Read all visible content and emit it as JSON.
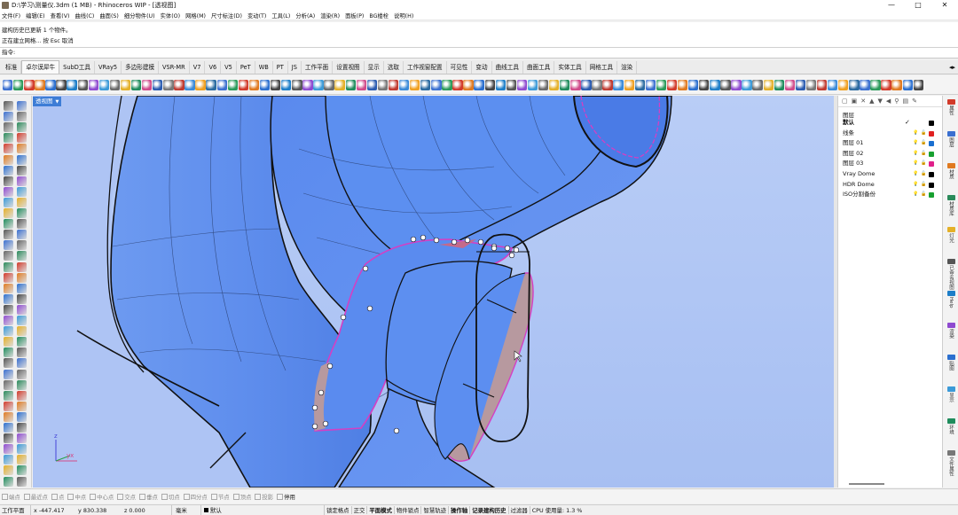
{
  "window": {
    "title": "D:\\学习\\测量仪.3dm (1 MB) - Rhinoceros WIP - [透视图]",
    "minimize": "—",
    "maximize": "□",
    "close": "✕"
  },
  "menu": [
    "文件(F)",
    "编辑(E)",
    "查看(V)",
    "曲线(C)",
    "曲面(S)",
    "细分物件(U)",
    "实体(O)",
    "网格(M)",
    "尺寸标注(D)",
    "变动(T)",
    "工具(L)",
    "分析(A)",
    "渲染(R)",
    "面板(P)",
    "BG楼栓",
    "说明(H)"
  ],
  "command_history": [
    "建构历史已更新 1 个物件。",
    "正在建立网格... 按 Esc 取消"
  ],
  "command_prompt": "指令:",
  "tabs": [
    "标准",
    "卓尔谟犀牛",
    "SubD工具",
    "VRay5",
    "多边形建模",
    "VSR-MR",
    "V7",
    "V6",
    "V5",
    "PeT",
    "WB",
    "PT",
    "JS",
    "工作平面",
    "设置视图",
    "显示",
    "选取",
    "工作视窗配置",
    "可见性",
    "变动",
    "曲线工具",
    "曲面工具",
    "实体工具",
    "网格工具",
    "渲染"
  ],
  "active_tab_index": 1,
  "viewport": {
    "label": "透视图",
    "axis_z": "z",
    "axis_yx": "yx"
  },
  "layers_panel": {
    "title": "图层",
    "layers": [
      {
        "name": "默认",
        "color": "#000000",
        "current": true,
        "bold": true
      },
      {
        "name": "线条",
        "color": "#e02020"
      },
      {
        "name": "图层 01",
        "color": "#1a6fd0"
      },
      {
        "name": "图层 02",
        "color": "#18a030"
      },
      {
        "name": "图层 03",
        "color": "#e0208a"
      },
      {
        "name": "Vray Dome",
        "color": "#000000"
      },
      {
        "name": "HDR Dome",
        "color": "#000000"
      },
      {
        "name": "ISO分割备份",
        "color": "#18a030"
      }
    ],
    "check": "✓"
  },
  "side_tabs": [
    "属性",
    "图层",
    "材质",
    "材质库",
    "灯光",
    "已命名视图",
    "Help",
    "渲染",
    "贴图",
    "显示",
    "环境",
    "文件属性"
  ],
  "osnaps": [
    {
      "label": "端点",
      "active": false
    },
    {
      "label": "最近点",
      "active": false
    },
    {
      "label": "点",
      "active": false
    },
    {
      "label": "中点",
      "active": false
    },
    {
      "label": "中心点",
      "active": false
    },
    {
      "label": "交点",
      "active": false
    },
    {
      "label": "垂点",
      "active": false
    },
    {
      "label": "切点",
      "active": false
    },
    {
      "label": "四分点",
      "active": false
    },
    {
      "label": "节点",
      "active": false
    },
    {
      "label": "顶点",
      "active": false
    },
    {
      "label": "投影",
      "active": false
    },
    {
      "label": "停用",
      "active": true
    }
  ],
  "status": {
    "cplane": "工作平面",
    "x": "x -447.417",
    "y": "y 830.338",
    "z": "z 0.000",
    "unit": "毫米",
    "layer": "默认",
    "toggles": [
      "锁定格点",
      "正交",
      "平面模式",
      "物件锁点",
      "智慧轨迹",
      "操作轴",
      "记录建构历史",
      "过滤器"
    ],
    "toggles_bold": [
      "平面模式",
      "操作轴",
      "记录建构历史"
    ],
    "cpu": "CPU 使用量: 1.3 %"
  },
  "colors": {
    "viewport_bg": "#aec4f4",
    "surface": "#5f90ee",
    "highlight": "#d43fc4",
    "inner": "#b7999f"
  }
}
